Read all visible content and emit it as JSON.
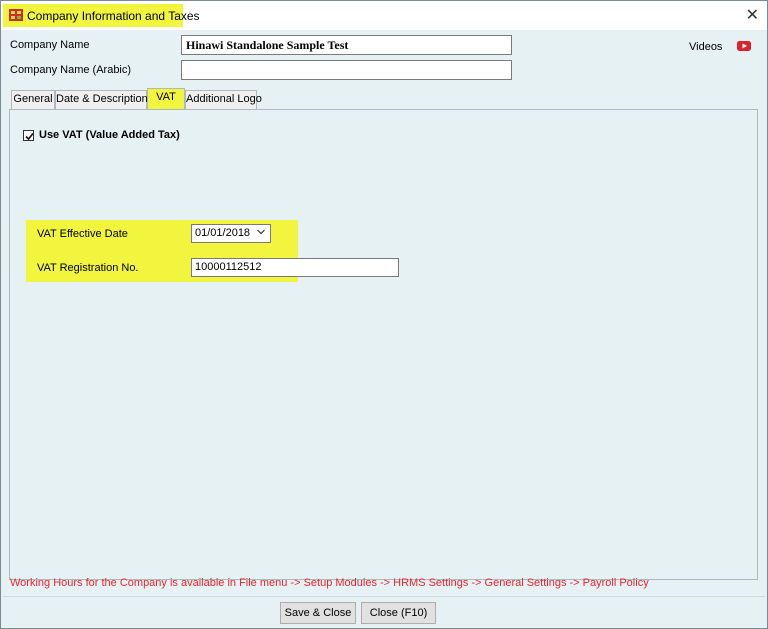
{
  "window": {
    "title": "Company Information and Taxes"
  },
  "company": {
    "name_label": "Company Name",
    "name_value": "Hinawi Standalone Sample Test",
    "arabic_label": "Company Name (Arabic)",
    "arabic_value": ""
  },
  "videos": {
    "label": "Videos",
    "icon": "youtube-icon"
  },
  "tabs": [
    {
      "label": "General"
    },
    {
      "label": "Date & Description"
    },
    {
      "label": "VAT",
      "active": true
    },
    {
      "label": "Additional Logo"
    }
  ],
  "vat": {
    "use_vat_label": "Use VAT (Value Added Tax)",
    "use_vat_checked": true,
    "effective_date_label": "VAT Effective Date",
    "effective_date_value": "01/01/2018",
    "registration_label": "VAT Registration No.",
    "registration_value": "10000112512"
  },
  "footer": {
    "note": "Working Hours for the Company is available in File menu -> Setup Modules -> HRMS Settings -> General Settings -> Payroll Policy",
    "save_label": "Save & Close",
    "close_label": "Close (F10)"
  },
  "colors": {
    "highlight": "#f2f53d",
    "note": "#e8262f",
    "panel": "#e6f1f4"
  }
}
